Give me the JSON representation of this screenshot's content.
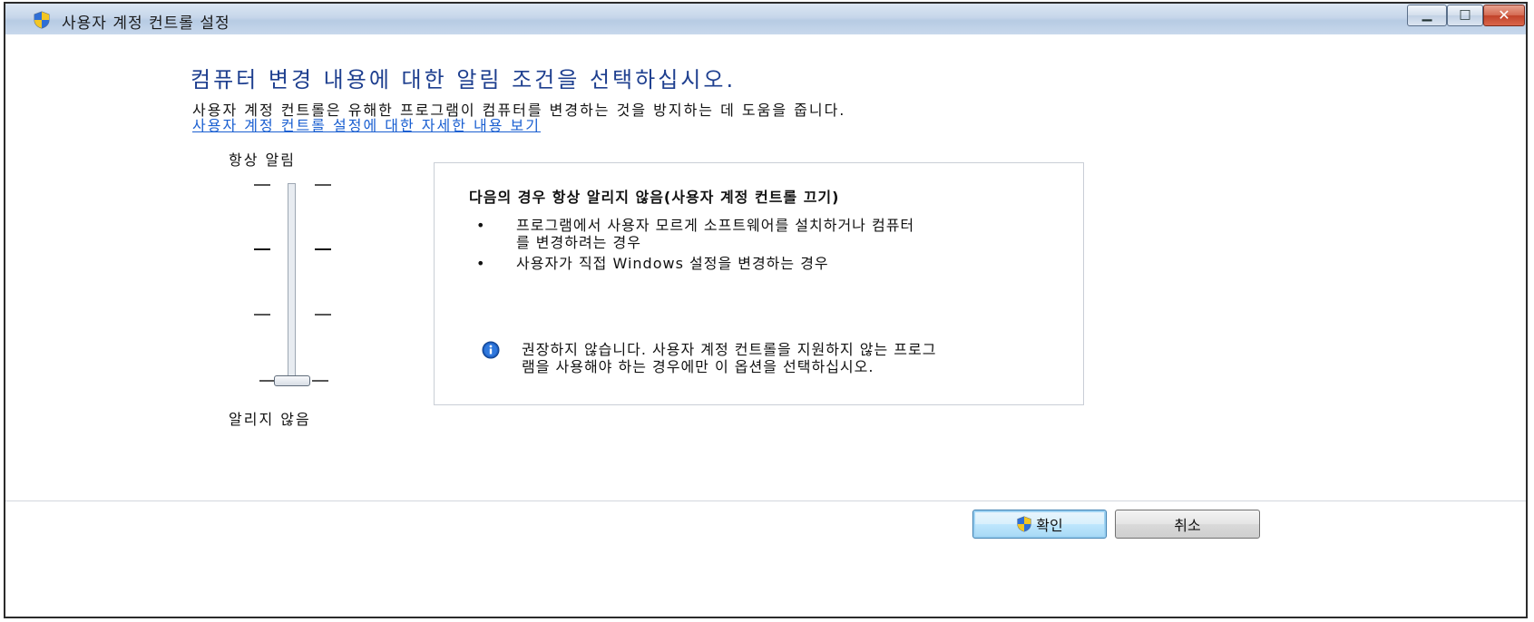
{
  "window": {
    "title": "사용자 계정 컨트롤 설정",
    "controls": {
      "minimize_icon": "minimize-icon",
      "maximize_icon": "maximize-icon",
      "close_icon": "close-icon"
    }
  },
  "main": {
    "heading": "컴퓨터 변경 내용에 대한 알림 조건을 선택하십시오.",
    "description": "사용자 계정 컨트롤은 유해한 프로그램이 컴퓨터를 변경하는 것을 방지하는 데 도움을 줍니다.",
    "help_link": "사용자 계정 컨트롤 설정에 대한 자세한 내용 보기"
  },
  "slider": {
    "top_label": "항상 알림",
    "bottom_label": "알리지 않음",
    "levels": 4,
    "selected_level": 1
  },
  "info_panel": {
    "title": "다음의 경우 항상 알리지 않음(사용자 계정 컨트롤 끄기)",
    "bullets": [
      "프로그램에서 사용자 모르게 소프트웨어를 설치하거나 컴퓨터를 변경하려는 경우",
      "사용자가 직접 Windows 설정을 변경하는 경우"
    ],
    "note": "권장하지 않습니다. 사용자 계정 컨트롤을 지원하지 않는 프로그램을 사용해야 하는 경우에만 이 옵션을 선택하십시오.",
    "note_icon": "info-icon"
  },
  "footer": {
    "ok_label": "확인",
    "cancel_label": "취소",
    "ok_icon": "shield-icon"
  },
  "colors": {
    "heading": "#1e3f8f",
    "link": "#1a5fd1",
    "ok_accent": "#3c7fb1"
  }
}
